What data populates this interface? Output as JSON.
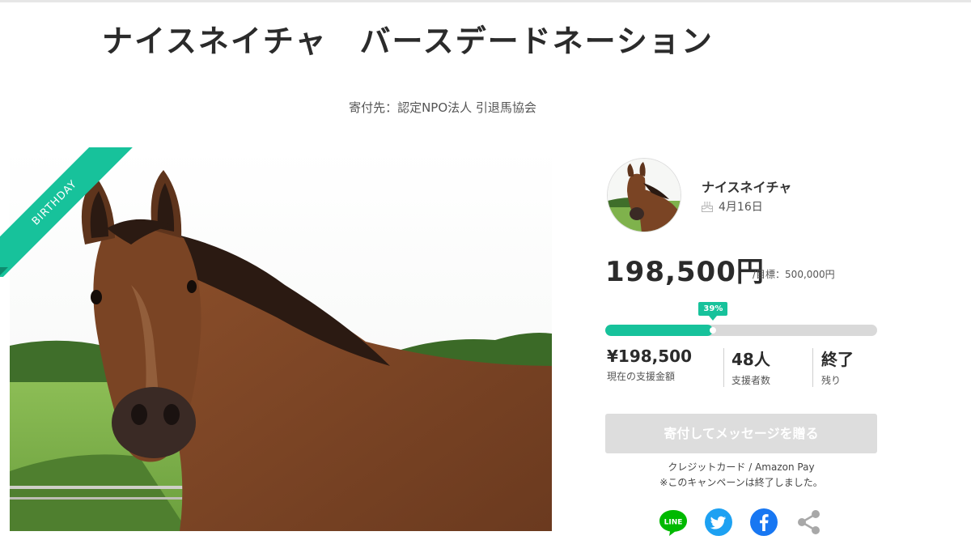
{
  "title": "ナイスネイチャ　バースデードネーション",
  "beneficiary": "寄付先：認定NPO法人 引退馬協会",
  "ribbon": "BIRTHDAY",
  "profile": {
    "name": "ナイスネイチャ",
    "birthday": "4月16日",
    "birthday_icon": "cake-icon"
  },
  "funding": {
    "amount": "198,500円",
    "goal": "/目標：500,000円",
    "percent_label": "39%",
    "progress_fraction": 0.397
  },
  "stats": [
    {
      "value": "¥198,500",
      "label": "現在の支援金額"
    },
    {
      "value": "48人",
      "label": "支援者数"
    },
    {
      "value": "終了",
      "label": "残り"
    }
  ],
  "cta": {
    "label": "寄付してメッセージを贈る",
    "disabled": true
  },
  "payment_methods": "クレジットカード / Amazon Pay",
  "campaign_status_note": "※このキャンペーンは終了しました。",
  "share": [
    {
      "icon": "line-icon",
      "label": "LINE",
      "color": "#00b900"
    },
    {
      "icon": "twitter-icon",
      "color": "#1da1f2"
    },
    {
      "icon": "facebook-icon",
      "color": "#1877f2"
    },
    {
      "icon": "share-icon",
      "color": "#aaaaaa"
    }
  ],
  "colors": {
    "accent": "#17c29b",
    "track": "#d9d9d9",
    "button_disabled": "#dddddd"
  }
}
